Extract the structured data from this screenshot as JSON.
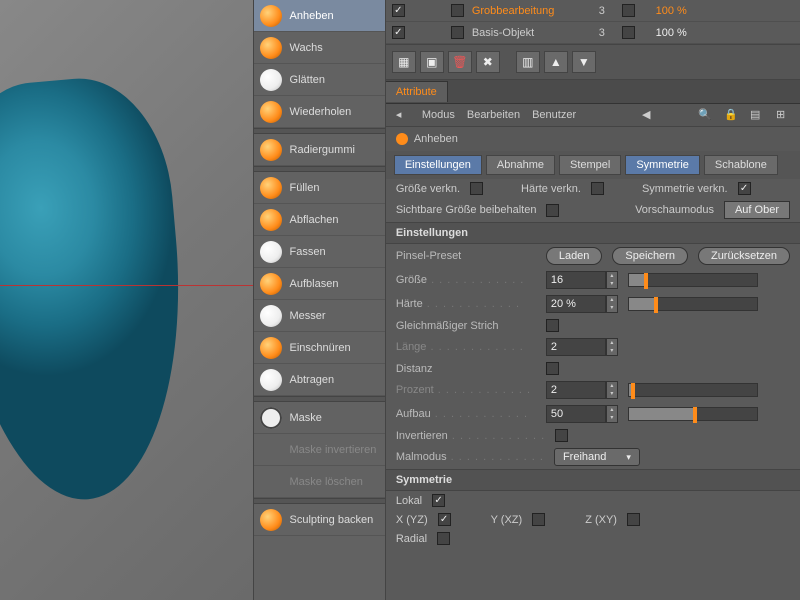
{
  "tools": [
    {
      "name": "Anheben",
      "icon": "orange",
      "selected": true
    },
    {
      "name": "Wachs",
      "icon": "orange"
    },
    {
      "name": "Glätten",
      "icon": "white"
    },
    {
      "name": "Wiederholen",
      "icon": "orange"
    },
    {
      "sep": true
    },
    {
      "name": "Radiergummi",
      "icon": "orange"
    },
    {
      "sep": true
    },
    {
      "name": "Füllen",
      "icon": "orange"
    },
    {
      "name": "Abflachen",
      "icon": "orange"
    },
    {
      "name": "Fassen",
      "icon": "white"
    },
    {
      "name": "Aufblasen",
      "icon": "orange"
    },
    {
      "name": "Messer",
      "icon": "white"
    },
    {
      "name": "Einschnüren",
      "icon": "orange"
    },
    {
      "name": "Abtragen",
      "icon": "white"
    },
    {
      "sep": true
    },
    {
      "name": "Maske",
      "icon": "square"
    },
    {
      "name": "Maske invertieren",
      "icon": "desat",
      "disabled": true
    },
    {
      "name": "Maske löschen",
      "icon": "desat",
      "disabled": true
    },
    {
      "sep": true
    },
    {
      "name": "Sculpting backen",
      "icon": "orange"
    }
  ],
  "layers": [
    {
      "name": "Grobbearbeitung",
      "lvl": "3",
      "pct": "100 %",
      "hl": true
    },
    {
      "name": "Basis-Objekt",
      "lvl": "3",
      "pct": "100 %"
    }
  ],
  "attr_tab": "Attribute",
  "menus": [
    "Modus",
    "Bearbeiten",
    "Benutzer"
  ],
  "object_name": "Anheben",
  "subtabs": [
    {
      "label": "Einstellungen",
      "blue": true
    },
    {
      "label": "Abnahme"
    },
    {
      "label": "Stempel"
    },
    {
      "label": "Symmetrie",
      "blue": true
    },
    {
      "label": "Schablone"
    }
  ],
  "link_row": {
    "size": "Größe verkn.",
    "size_chk": false,
    "hard": "Härte verkn.",
    "hard_chk": false,
    "sym": "Symmetrie verkn.",
    "sym_chk": true
  },
  "visible_row": {
    "lbl": "Sichtbare Größe beibehalten",
    "chk": false,
    "preview_lbl": "Vorschaumodus",
    "preview_btn": "Auf Ober"
  },
  "sections": {
    "settings": "Einstellungen",
    "symmetry": "Symmetrie"
  },
  "preset": {
    "lbl": "Pinsel-Preset",
    "load": "Laden",
    "save": "Speichern",
    "reset": "Zurücksetzen"
  },
  "params": {
    "size": {
      "lbl": "Größe",
      "val": "16",
      "pct": 12
    },
    "hard": {
      "lbl": "Härte",
      "val": "20 %",
      "pct": 20
    },
    "even": {
      "lbl": "Gleichmäßiger Strich",
      "chk": false
    },
    "len": {
      "lbl": "Länge",
      "val": "2"
    },
    "dist": {
      "lbl": "Distanz",
      "chk": false
    },
    "perc": {
      "lbl": "Prozent",
      "val": "2"
    },
    "build": {
      "lbl": "Aufbau",
      "val": "50",
      "pct": 50
    },
    "invert": {
      "lbl": "Invertieren",
      "chk": false
    },
    "mode": {
      "lbl": "Malmodus",
      "val": "Freihand"
    }
  },
  "symmetry": {
    "local": {
      "lbl": "Lokal",
      "chk": true
    },
    "x": {
      "lbl": "X (YZ)",
      "chk": true
    },
    "y": {
      "lbl": "Y (XZ)",
      "chk": false
    },
    "z": {
      "lbl": "Z (XY)",
      "chk": false
    },
    "radial": {
      "lbl": "Radial",
      "chk": false
    }
  }
}
